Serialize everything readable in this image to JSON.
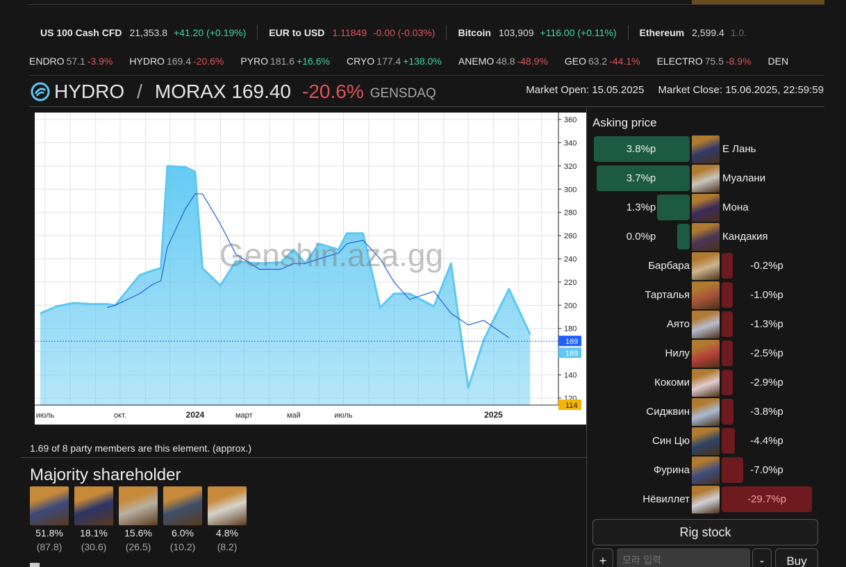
{
  "ticker": [
    {
      "name": "US 100 Cash CFD",
      "price": "21,353.8",
      "price_dir": "neutral",
      "change": "+41.20 (+0.19%)",
      "dir": "up"
    },
    {
      "name": "EUR to USD",
      "price": "1.11849",
      "price_dir": "down",
      "change": "-0.00 (-0.03%)",
      "dir": "down"
    },
    {
      "name": "Bitcoin",
      "price": "103,909",
      "price_dir": "neutral",
      "change": "+116.00 (+0.11%)",
      "dir": "up"
    },
    {
      "name": "Ethereum",
      "price": "2,599.4",
      "price_dir": "neutral",
      "change": "1.0.",
      "dir": "neutral"
    }
  ],
  "elements": [
    {
      "name": "ENDRO",
      "value": "57.1",
      "change": "-3.9%",
      "dir": "down"
    },
    {
      "name": "HYDRO",
      "value": "169.4",
      "change": "-20.6%",
      "dir": "down"
    },
    {
      "name": "PYRO",
      "value": "181.6",
      "change": "+16.6%",
      "dir": "up"
    },
    {
      "name": "CRYO",
      "value": "177.4",
      "change": "+138.0%",
      "dir": "up"
    },
    {
      "name": "ANEMO",
      "value": "48.8",
      "change": "-48.9%",
      "dir": "down"
    },
    {
      "name": "GEO",
      "value": "63.2",
      "change": "-44.1%",
      "dir": "down"
    },
    {
      "name": "ELECTRO",
      "value": "75.5",
      "change": "-8.9%",
      "dir": "down"
    },
    {
      "name": "DEN",
      "value": "",
      "change": "",
      "dir": "neutral"
    }
  ],
  "header": {
    "element": "HYDRO",
    "slash": "/",
    "pair": "MORAX 169.40",
    "change": "-20.6%",
    "exchange": "GENSDAQ",
    "market_open": "Market Open: 15.05.2025",
    "market_close": "Market Close: 15.06.2025, 22:59:59",
    "accent": "#5ec8f2"
  },
  "chart_data": {
    "type": "area",
    "watermark": "Genshin.aza.gg",
    "x": [
      "2023-06-25",
      "2023-07-15",
      "2023-08-05",
      "2023-08-25",
      "2023-09-15",
      "2023-09-25",
      "2023-10-25",
      "2023-11-10",
      "2023-11-20",
      "2023-11-28",
      "2023-12-20",
      "2024-01-01",
      "2024-01-10",
      "2024-02-01",
      "2024-02-20",
      "2024-03-20",
      "2024-04-15",
      "2024-05-01",
      "2024-05-15",
      "2024-06-01",
      "2024-06-25",
      "2024-07-05",
      "2024-07-25",
      "2024-08-15",
      "2024-09-01",
      "2024-09-20",
      "2024-10-20",
      "2024-11-10",
      "2024-12-01",
      "2024-12-20",
      "2025-01-20",
      "2025-02-15",
      "2025-03-05"
    ],
    "series": [
      {
        "values": [
          193,
          199,
          202,
          201,
          201,
          200,
          226,
          230,
          232,
          320,
          319,
          315,
          232,
          217,
          238,
          236,
          237,
          248,
          236,
          253,
          248,
          262,
          262,
          198,
          210,
          210,
          199,
          236,
          129,
          170,
          214,
          175,
          null
        ]
      },
      {
        "values": [
          null,
          null,
          null,
          null,
          198,
          200,
          210,
          218,
          221,
          250,
          283,
          296,
          296,
          270,
          244,
          231,
          231,
          236,
          236,
          240,
          245,
          253,
          256,
          240,
          220,
          205,
          212,
          193,
          183,
          187,
          172,
          null,
          null
        ]
      }
    ],
    "y_ticks": [
      "360",
      "340",
      "320",
      "300",
      "280",
      "260",
      "240",
      "220",
      "200",
      "180",
      "160",
      "140",
      "120"
    ],
    "x_ticks": [
      "июль",
      "окт.",
      "2024",
      "март",
      "май",
      "июль",
      "2025"
    ],
    "ylim": [
      114,
      366
    ],
    "price_tag": "169",
    "price_tag_2": "169",
    "low_tag": "114",
    "line_color": "#5ec8f2",
    "ma_color": "#1f5fd6"
  },
  "note": "1.69 of 8 party members are this element. (approx.)",
  "majority": {
    "title": "Majority shareholder",
    "holders": [
      {
        "pct": "51.8%",
        "amount": "(87.8)",
        "color": "#3b4a7a"
      },
      {
        "pct": "18.1%",
        "amount": "(30.6)",
        "color": "#2b3566"
      },
      {
        "pct": "15.6%",
        "amount": "(26.5)",
        "color": "#b9b0a2"
      },
      {
        "pct": "6.0%",
        "amount": "(10.2)",
        "color": "#3d4f6c"
      },
      {
        "pct": "4.8%",
        "amount": "(8.2)",
        "color": "#d6d3cc"
      }
    ]
  },
  "asking": {
    "title": "Asking price",
    "rows": [
      {
        "name": "Е Лань",
        "pct": "3.8%р",
        "side": "pos",
        "frac": 1.0,
        "color": "#2f3a6a"
      },
      {
        "name": "Муалани",
        "pct": "3.7%р",
        "side": "pos",
        "frac": 0.974,
        "color": "#c8c4bf"
      },
      {
        "name": "Мона",
        "pct": "1.3%р",
        "side": "pos",
        "frac": 0.342,
        "color": "#3a2c5a"
      },
      {
        "name": "Кандакия",
        "pct": "0.0%р",
        "side": "pos",
        "frac": 0.0,
        "color": "#4a3656"
      },
      {
        "name": "Барбара",
        "pct": "-0.2%р",
        "side": "neg",
        "frac": 0.007,
        "color": "#cdb58e"
      },
      {
        "name": "Тарталья",
        "pct": "-1.0%р",
        "side": "neg",
        "frac": 0.034,
        "color": "#a7553a"
      },
      {
        "name": "Аято",
        "pct": "-1.3%р",
        "side": "neg",
        "frac": 0.044,
        "color": "#b7bccd"
      },
      {
        "name": "Нилу",
        "pct": "-2.5%р",
        "side": "neg",
        "frac": 0.084,
        "color": "#b8423a"
      },
      {
        "name": "Кокоми",
        "pct": "-2.9%р",
        "side": "neg",
        "frac": 0.098,
        "color": "#e2cbd0"
      },
      {
        "name": "Сиджвин",
        "pct": "-3.8%р",
        "side": "neg",
        "frac": 0.128,
        "color": "#a9bcd4"
      },
      {
        "name": "Син Цю",
        "pct": "-4.4%р",
        "side": "neg",
        "frac": 0.148,
        "color": "#2c4466"
      },
      {
        "name": "Фурина",
        "pct": "-7.0%р",
        "side": "neg",
        "frac": 0.236,
        "color": "#3d4e82"
      },
      {
        "name": "Нёвиллет",
        "pct": "-29.7%р",
        "side": "neg",
        "frac": 1.0,
        "color": "#cfd0d6"
      }
    ]
  },
  "actions": {
    "rig": "Rig stock",
    "plus": "+",
    "amount_placeholder": "모라 입력",
    "minus": "-",
    "buy": "Buy"
  }
}
